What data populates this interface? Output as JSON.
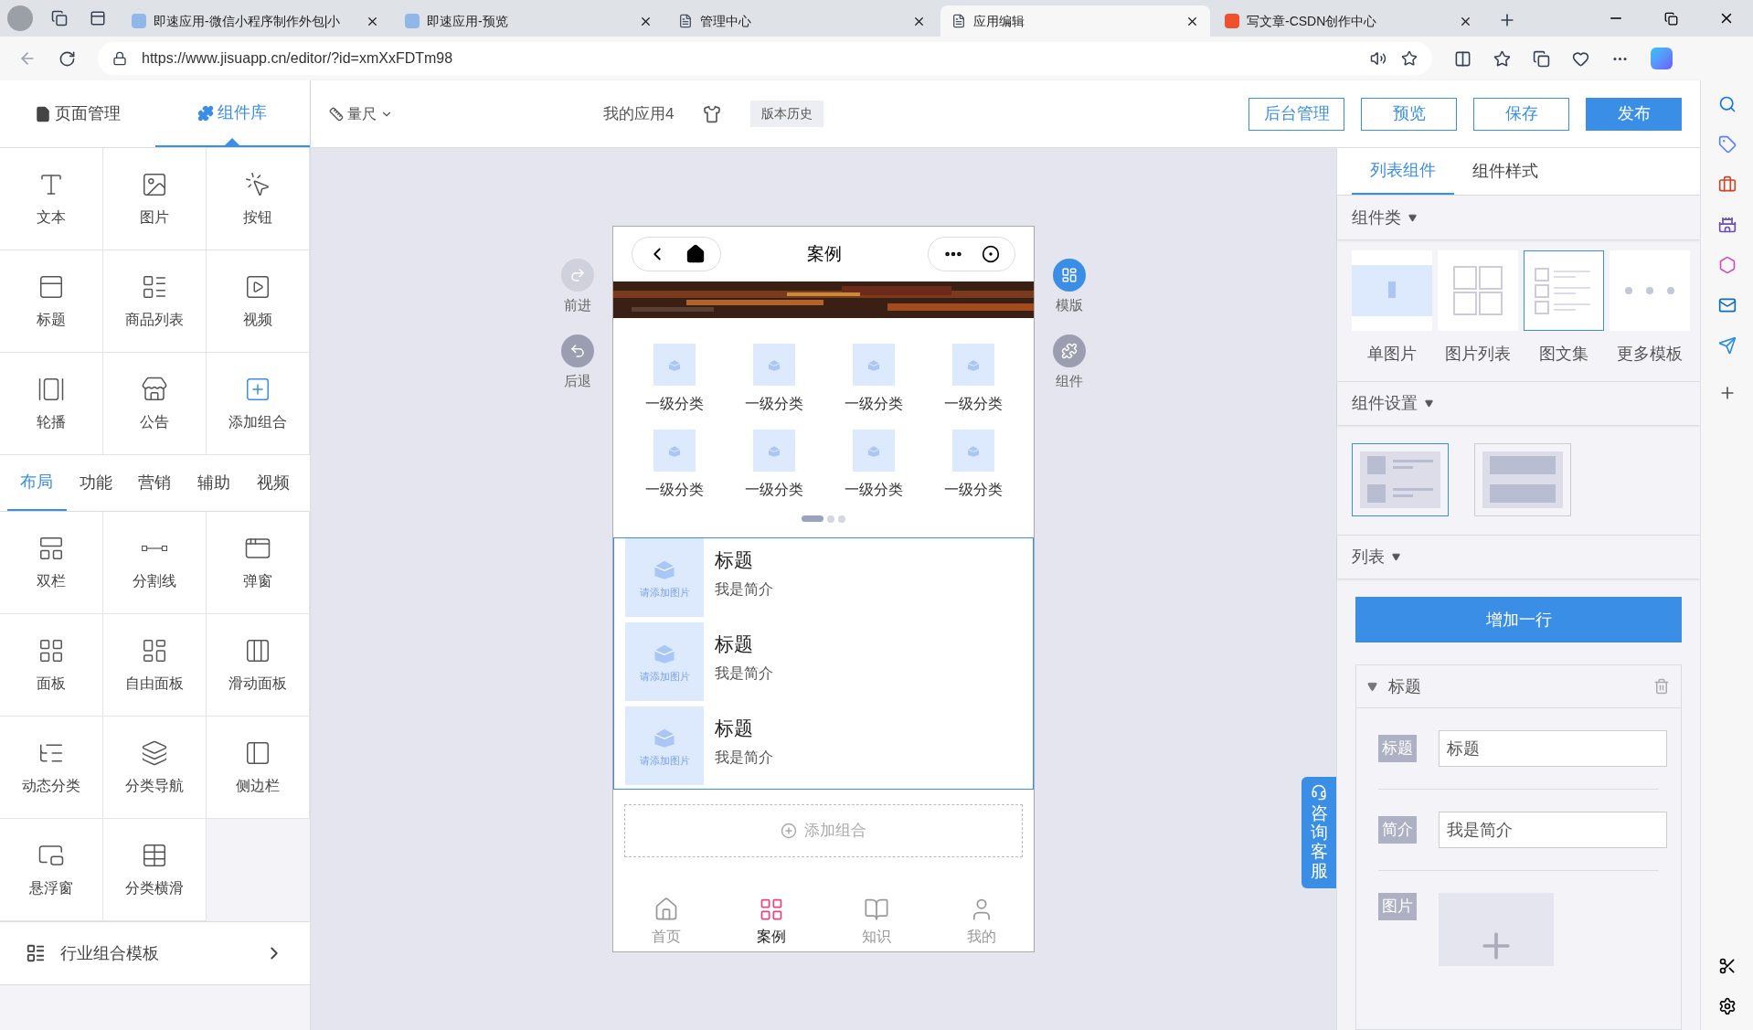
{
  "browser": {
    "tabs": [
      {
        "title": "即速应用-微信小程序制作外包|小",
        "selected": false,
        "kind": "site"
      },
      {
        "title": "即速应用-预览",
        "selected": false,
        "kind": "site"
      },
      {
        "title": "管理中心",
        "selected": false,
        "kind": "page"
      },
      {
        "title": "应用编辑",
        "selected": true,
        "kind": "page"
      },
      {
        "title": "写文章-CSDN创作中心",
        "selected": false,
        "kind": "csdn"
      }
    ],
    "url": "https://www.jisuapp.cn/editor/?id=xmXxFDTm98"
  },
  "left_panel": {
    "tabs": [
      {
        "label": "页面管理",
        "selected": false
      },
      {
        "label": "组件库",
        "selected": true
      }
    ],
    "basic_components": [
      {
        "label": "文本"
      },
      {
        "label": "图片"
      },
      {
        "label": "按钮"
      },
      {
        "label": "标题"
      },
      {
        "label": "商品列表"
      },
      {
        "label": "视频"
      },
      {
        "label": "轮播"
      },
      {
        "label": "公告"
      },
      {
        "label": "添加组合"
      }
    ],
    "category_tabs": [
      {
        "label": "布局",
        "selected": true
      },
      {
        "label": "功能",
        "selected": false
      },
      {
        "label": "营销",
        "selected": false
      },
      {
        "label": "辅助",
        "selected": false
      },
      {
        "label": "视频",
        "selected": false
      }
    ],
    "layout_components": [
      {
        "label": "双栏"
      },
      {
        "label": "分割线"
      },
      {
        "label": "弹窗"
      },
      {
        "label": "面板"
      },
      {
        "label": "自由面板"
      },
      {
        "label": "滑动面板"
      },
      {
        "label": "动态分类"
      },
      {
        "label": "分类导航"
      },
      {
        "label": "侧边栏"
      },
      {
        "label": "悬浮窗"
      },
      {
        "label": "分类横滑"
      }
    ],
    "template_link": "行业组合模板"
  },
  "toolbar": {
    "ruler": "量尺",
    "app_name": "我的应用4",
    "version_history": "版本历史",
    "buttons": [
      {
        "label": "后台管理",
        "kind": "outline"
      },
      {
        "label": "预览",
        "kind": "outline"
      },
      {
        "label": "保存",
        "kind": "outline"
      },
      {
        "label": "发布",
        "kind": "primary"
      }
    ]
  },
  "canvas": {
    "left_actions": [
      {
        "label": "前进"
      },
      {
        "label": "后退"
      }
    ],
    "right_actions": [
      {
        "label": "模版"
      },
      {
        "label": "组件"
      }
    ],
    "phone": {
      "title": "案例",
      "categories": [
        "一级分类",
        "一级分类",
        "一级分类",
        "一级分类",
        "一级分类",
        "一级分类",
        "一级分类",
        "一级分类"
      ],
      "list": [
        {
          "title": "标题",
          "intro": "我是简介",
          "image_hint": "请添加图片"
        },
        {
          "title": "标题",
          "intro": "我是简介",
          "image_hint": "请添加图片"
        },
        {
          "title": "标题",
          "intro": "我是简介",
          "image_hint": "请添加图片"
        }
      ],
      "add_group": "添加组合",
      "nav": [
        {
          "label": "首页",
          "selected": false
        },
        {
          "label": "案例",
          "selected": true
        },
        {
          "label": "知识",
          "selected": false
        },
        {
          "label": "我的",
          "selected": false
        }
      ]
    },
    "consult": "咨询客服"
  },
  "right_panel": {
    "tabs": [
      {
        "label": "列表组件",
        "selected": true
      },
      {
        "label": "组件样式",
        "selected": false
      }
    ],
    "type_section": "组件类",
    "types": [
      {
        "label": "单图片",
        "selected": false,
        "kind": "single"
      },
      {
        "label": "图片列表",
        "selected": false,
        "kind": "grid"
      },
      {
        "label": "图文集",
        "selected": true,
        "kind": "list"
      },
      {
        "label": "更多模板",
        "selected": false,
        "kind": "more"
      }
    ],
    "settings_section": "组件设置",
    "layouts": [
      {
        "selected": true,
        "kind": "rows"
      },
      {
        "selected": false,
        "kind": "blocks"
      }
    ],
    "list_section": "列表",
    "add_row": "增加一行",
    "item": {
      "title": "标题",
      "expanded": true,
      "fields": [
        {
          "label": "标题",
          "value": "标题"
        },
        {
          "label": "简介",
          "value": "我是简介"
        }
      ],
      "image_label": "图片"
    }
  }
}
